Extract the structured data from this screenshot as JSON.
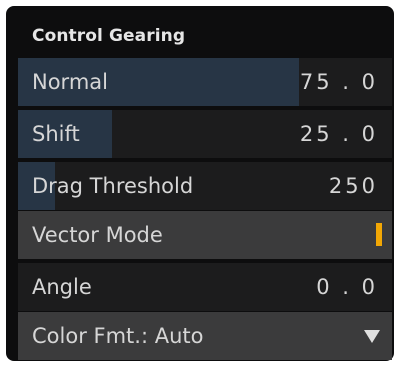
{
  "panel": {
    "title": "Control Gearing"
  },
  "rows": [
    {
      "label": "Normal",
      "value": "75 . 0",
      "fill_percent": 75
    },
    {
      "label": "Shift",
      "value": "25 . 0",
      "fill_percent": 25
    },
    {
      "label": "Drag Threshold",
      "value": "250",
      "fill_percent": 10
    },
    {
      "label": "Vector Mode",
      "toggle_on": true
    },
    {
      "label": "Angle",
      "value": "0 . 0"
    },
    {
      "label": "Color Fmt.: Auto",
      "icon": "dropdown-triangle-icon"
    }
  ],
  "colors": {
    "accent": "#f2a705",
    "slider_fill": "#273545",
    "panel_bg": "#0d0d0e",
    "row_bg": "#1c1c1d",
    "row_bg_alt": "#3b3b3c"
  }
}
